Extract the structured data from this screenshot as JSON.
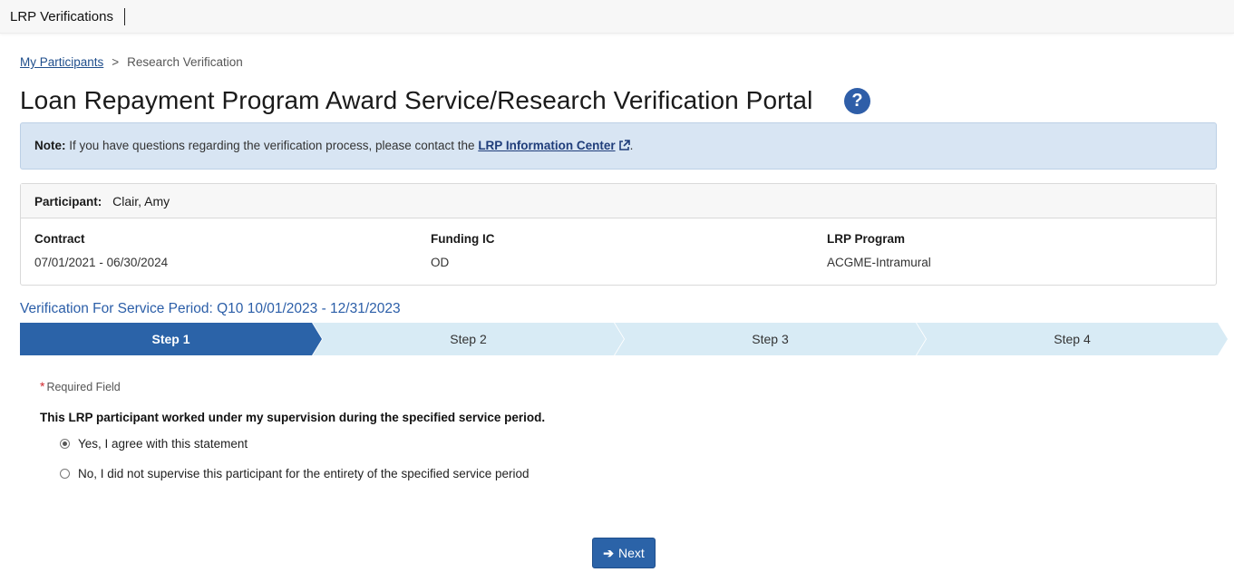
{
  "app": {
    "title": "LRP Verifications"
  },
  "breadcrumb": {
    "link": "My Participants",
    "separator": ">",
    "current": "Research Verification"
  },
  "page": {
    "title": "Loan Repayment Program Award Service/Research Verification Portal",
    "help_icon": "question-circle-icon"
  },
  "note": {
    "label": "Note:",
    "text": "If you have questions regarding the verification process, please contact the",
    "link": "LRP Information Center",
    "link_icon": "external-link-icon",
    "end": "."
  },
  "participant": {
    "label": "Participant:",
    "name": "Clair, Amy",
    "contract_label": "Contract",
    "contract_value": "07/01/2021 - 06/30/2024",
    "funding_label": "Funding IC",
    "funding_value": "OD",
    "program_label": "LRP Program",
    "program_value": "ACGME-Intramural"
  },
  "period": {
    "title": "Verification For Service Period: Q10 10/01/2023 - 12/31/2023"
  },
  "steps": [
    {
      "label": "Step 1",
      "active": true
    },
    {
      "label": "Step 2",
      "active": false
    },
    {
      "label": "Step 3",
      "active": false
    },
    {
      "label": "Step 4",
      "active": false
    }
  ],
  "form": {
    "required_marker": "*",
    "required_text": "Required Field",
    "question": "This LRP participant worked under my supervision during the specified service period.",
    "options": [
      {
        "label": "Yes, I agree with this statement",
        "selected": true
      },
      {
        "label": "No, I did not supervise this participant for the entirety of the specified service period",
        "selected": false
      }
    ]
  },
  "actions": {
    "next_label": "Next",
    "next_icon": "arrow-right-icon"
  },
  "colors": {
    "primary": "#2b63a8",
    "step_inactive": "#d8ebf5",
    "note_bg": "#d8e5f3",
    "link": "#1f4e8c",
    "required": "#d0282e"
  }
}
